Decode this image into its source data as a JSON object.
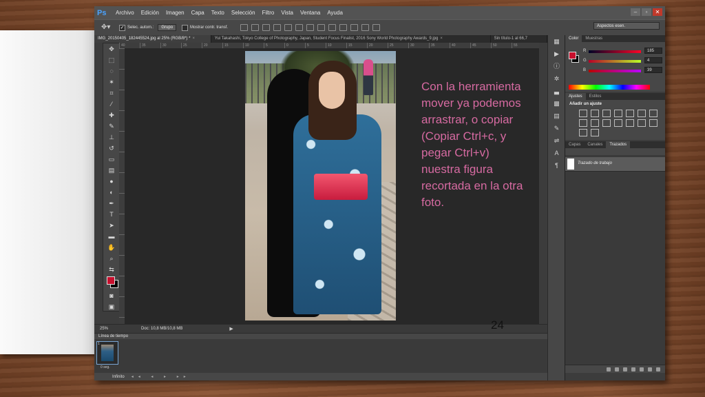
{
  "app": {
    "logo": "Ps",
    "menu": [
      "Archivo",
      "Edición",
      "Imagen",
      "Capa",
      "Texto",
      "Selección",
      "Filtro",
      "Vista",
      "Ventana",
      "Ayuda"
    ]
  },
  "options_bar": {
    "auto_select_label": "Selec. autom.:",
    "auto_select_value": "Grupo",
    "show_transform_label": "Mostrar contr. transf.",
    "workspace": "Aspectos esen."
  },
  "tabs": [
    {
      "label": "IMG_20150405_182445524.jpg al 25% (RGB/8*) *",
      "close": "×",
      "active": true
    },
    {
      "label": "Yui Takahashi, Tokyo College of Photography, Japan, Student Focus Finalist, 2016 Sony World Photography Awards_9.jpg",
      "close": "×",
      "active": false
    },
    {
      "label": "Sin título-1 al 66,7",
      "close": "",
      "active": false
    }
  ],
  "ruler_ticks": [
    "40",
    "35",
    "30",
    "25",
    "20",
    "15",
    "10",
    "5",
    "0",
    "5",
    "10",
    "15",
    "20",
    "25",
    "30",
    "35",
    "40",
    "45",
    "50",
    "55"
  ],
  "status_bar": {
    "zoom": "25%",
    "doc": "Doc: 10,8 MB/10,8 MB",
    "arrow": "▶"
  },
  "timeline": {
    "title": "Línea de tiempo",
    "frame_number": "1",
    "frame_delay": "0 seg.",
    "loop": "Infinito",
    "controls": "◂◂ ◂ ▸ ▸▸"
  },
  "panels": {
    "color_tabs": [
      "Color",
      "Muestras"
    ],
    "rgb": [
      {
        "label": "R",
        "value": "185"
      },
      {
        "label": "G",
        "value": "4"
      },
      {
        "label": "B",
        "value": "39"
      }
    ],
    "adjust_tabs": [
      "Ajustes",
      "Estilos"
    ],
    "adjust_title": "Añadir un ajuste",
    "layer_tabs": [
      "Capas",
      "Canales",
      "Trazados"
    ],
    "path_name": "Trazado de trabajo"
  },
  "slide": {
    "text": "Con la herramienta mover ya podemos arrastrar, o copiar (Copiar Ctrl+c, y pegar Ctrl+v) nuestra figura recortada en la otra foto.",
    "page_number": "24"
  },
  "colors": {
    "foreground": "#c8102e",
    "background": "#000000",
    "slide_text": "#d66aa1",
    "workspace_bg": "#282828"
  }
}
